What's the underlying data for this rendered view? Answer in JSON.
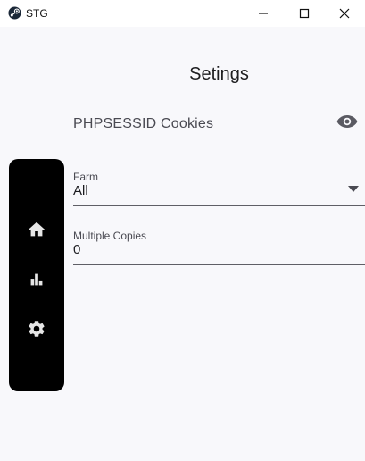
{
  "window": {
    "title": "STG",
    "controls": {
      "minimize_icon": "minimize-icon",
      "maximize_icon": "maximize-icon",
      "close_icon": "close-icon"
    }
  },
  "page": {
    "title": "Setings"
  },
  "nav": {
    "items": [
      {
        "name": "home",
        "icon": "home-icon"
      },
      {
        "name": "stats",
        "icon": "bar-chart-icon"
      },
      {
        "name": "settings",
        "icon": "gear-icon"
      }
    ]
  },
  "form": {
    "cookies": {
      "placeholder": "PHPSESSID Cookies",
      "value": "",
      "visibility_icon": "eye-icon"
    },
    "farm": {
      "label": "Farm",
      "selected": "All"
    },
    "copies": {
      "label": "Multiple Copies",
      "value": "0"
    }
  },
  "colors": {
    "rail_background": "#000000",
    "content_background": "#f8f8fb",
    "underline": "#5f5f66"
  }
}
